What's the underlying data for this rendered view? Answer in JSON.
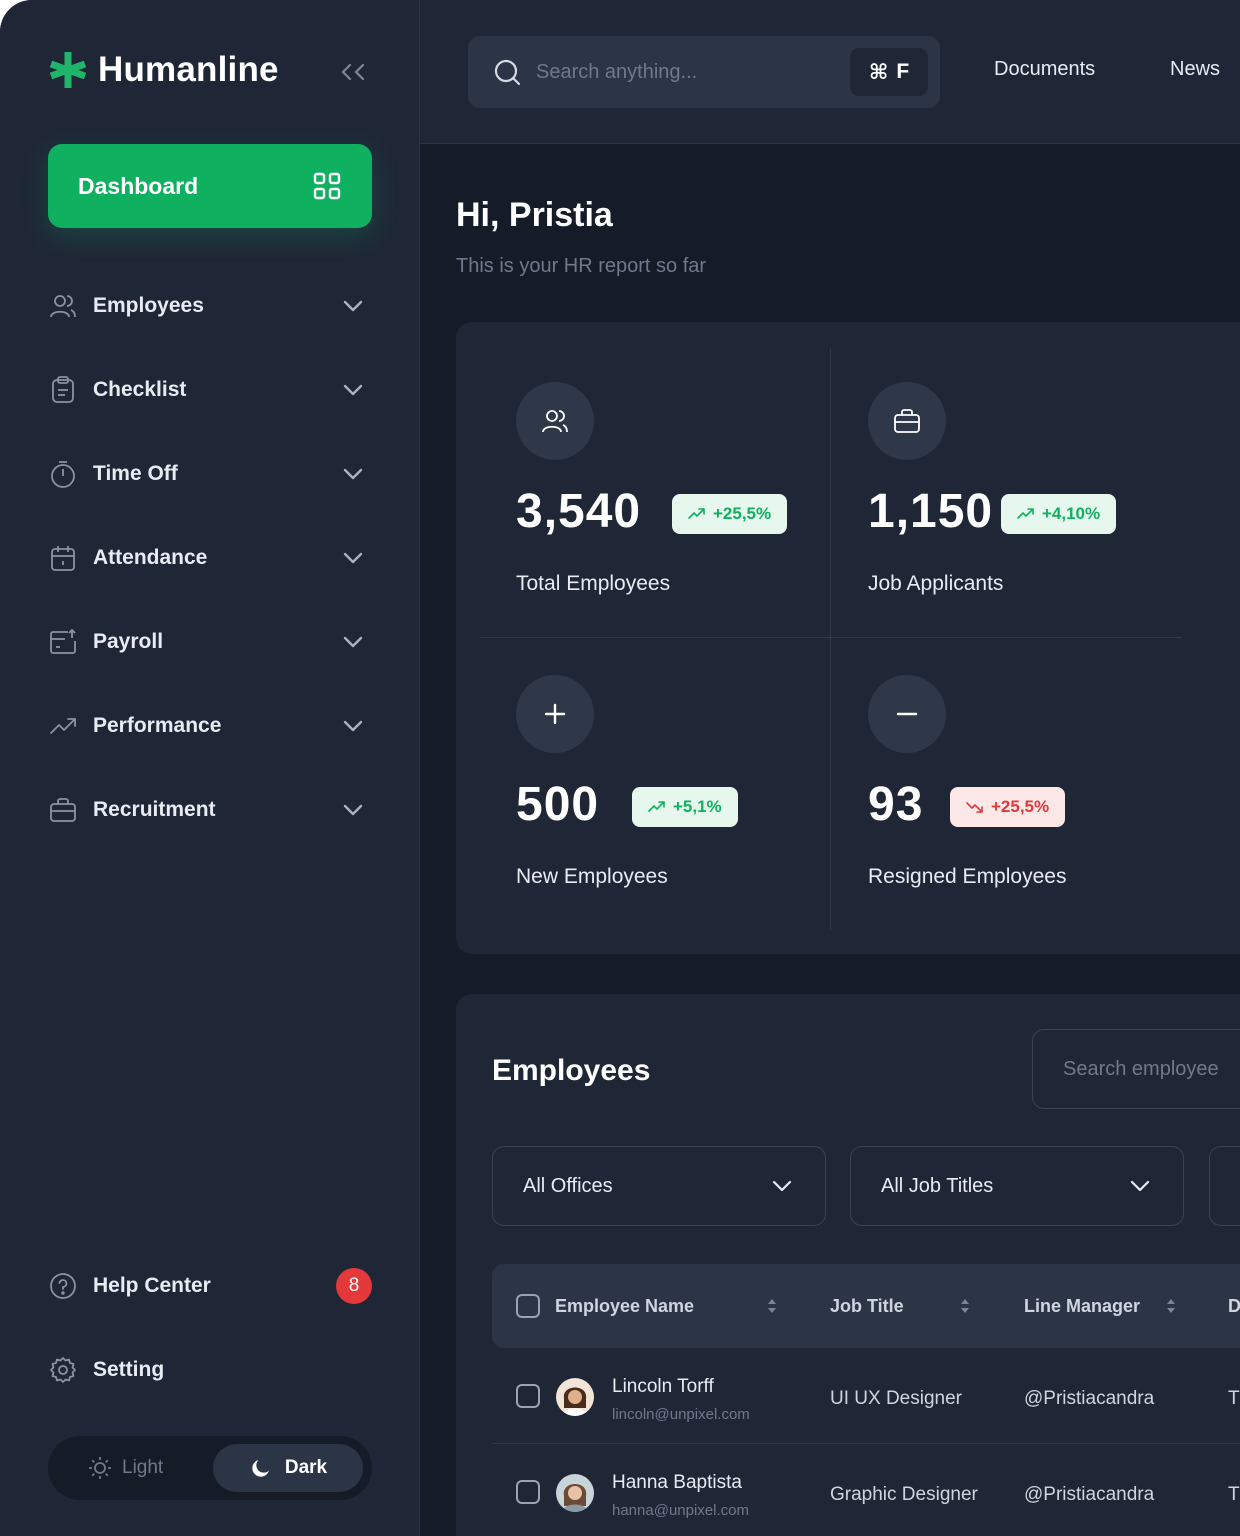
{
  "app": {
    "name": "Humanline"
  },
  "sidebar": {
    "dashboard_label": "Dashboard",
    "items": [
      {
        "label": "Employees",
        "icon": "users-icon"
      },
      {
        "label": "Checklist",
        "icon": "clipboard-icon"
      },
      {
        "label": "Time Off",
        "icon": "stopwatch-icon"
      },
      {
        "label": "Attendance",
        "icon": "calendar-icon"
      },
      {
        "label": "Payroll",
        "icon": "payroll-icon"
      },
      {
        "label": "Performance",
        "icon": "trend-icon"
      },
      {
        "label": "Recruitment",
        "icon": "briefcase-icon"
      }
    ],
    "help_label": "Help Center",
    "help_badge": "8",
    "setting_label": "Setting",
    "theme": {
      "light": "Light",
      "dark": "Dark",
      "selected": "Dark"
    }
  },
  "topbar": {
    "search_placeholder": "Search anything...",
    "shortcut_symbol": "⌘",
    "shortcut_key": "F",
    "links": [
      "Documents",
      "News"
    ]
  },
  "greeting": {
    "title": "Hi, Pristia",
    "subtitle": "This is your HR report so far"
  },
  "stats": [
    {
      "value": "3,540",
      "change": "+25,5%",
      "trend": "up",
      "label": "Total  Employees",
      "icon": "users-icon"
    },
    {
      "value": "1,150",
      "change": "+4,10%",
      "trend": "up",
      "label": "Job Applicants",
      "icon": "briefcase-icon"
    },
    {
      "value": "500",
      "change": "+5,1%",
      "trend": "up",
      "label": "New  Employees",
      "icon": "plus-icon"
    },
    {
      "value": "93",
      "change": "+25,5%",
      "trend": "down",
      "label": "Resigned Employees",
      "icon": "minus-icon"
    }
  ],
  "employees": {
    "title": "Employees",
    "search_placeholder": "Search employee",
    "filters": [
      "All Offices",
      "All Job Titles"
    ],
    "columns": [
      "Employee Name",
      "Job Title",
      "Line Manager",
      "D"
    ],
    "rows": [
      {
        "name": "Lincoln Torff",
        "email": "lincoln@unpixel.com",
        "job_title": "UI UX Designer",
        "manager": "@Pristiacandra",
        "next": "T"
      },
      {
        "name": "Hanna Baptista",
        "email": "hanna@unpixel.com",
        "job_title": "Graphic Designer",
        "manager": "@Pristiacandra",
        "next": "T"
      }
    ]
  },
  "colors": {
    "accent": "#0fb160",
    "danger": "#e5383b",
    "sidebar": "#1f2737",
    "background": "#151c28"
  }
}
